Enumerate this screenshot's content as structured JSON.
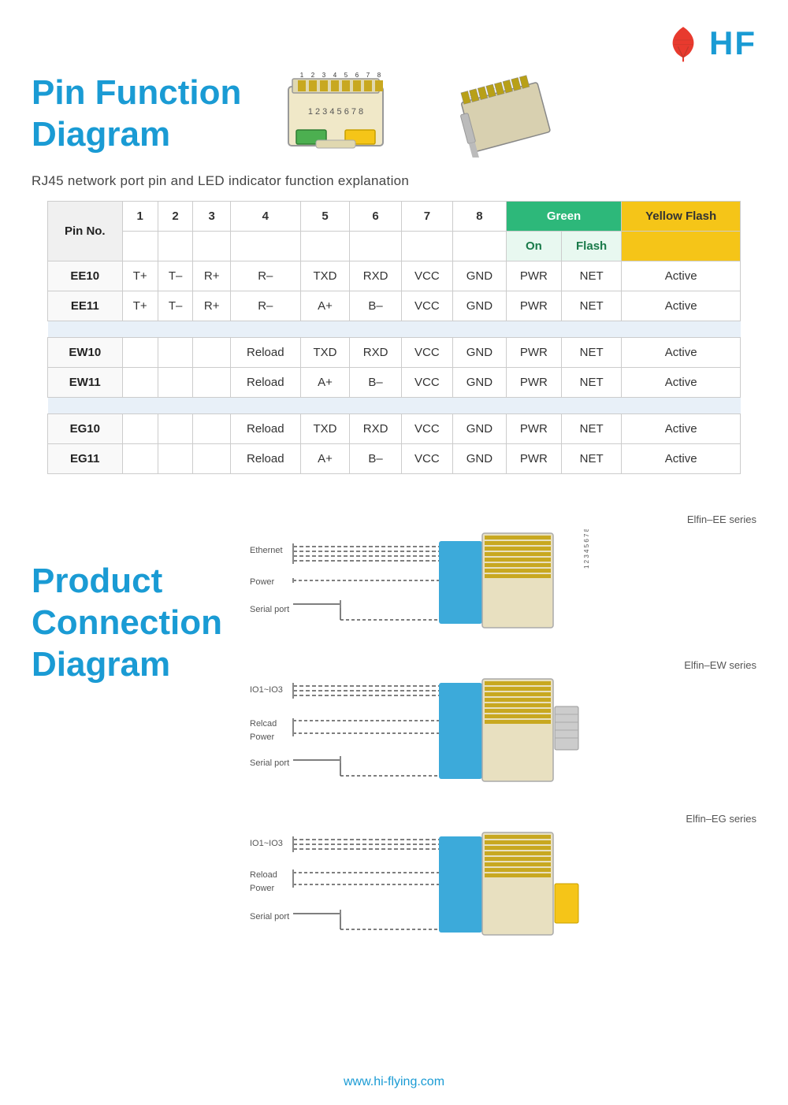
{
  "header": {
    "logo_text": "HF",
    "website": "www.hi-flying.com"
  },
  "title": {
    "main": "Pin Function",
    "sub": "Diagram"
  },
  "subtitle": "RJ45 network port pin and LED indicator function explanation",
  "table": {
    "col_header": [
      "Pin No.",
      "1",
      "2",
      "3",
      "4",
      "5",
      "6",
      "7",
      "8"
    ],
    "led_headers": {
      "green": "Green",
      "green_on": "On",
      "green_flash": "Flash",
      "yellow_flash": "Yellow Flash"
    },
    "rows": [
      {
        "label": "EE10",
        "pins": [
          "T+",
          "T–",
          "R+",
          "R–",
          "TXD",
          "RXD",
          "VCC",
          "GND"
        ],
        "led": [
          "PWR",
          "NET",
          "Active"
        ]
      },
      {
        "label": "EE11",
        "pins": [
          "T+",
          "T–",
          "R+",
          "R–",
          "A+",
          "B–",
          "VCC",
          "GND"
        ],
        "led": [
          "PWR",
          "NET",
          "Active"
        ]
      },
      {
        "label": "EW10",
        "pins": [
          "",
          "",
          "",
          "Reload",
          "TXD",
          "RXD",
          "VCC",
          "GND"
        ],
        "led": [
          "PWR",
          "NET",
          "Active"
        ]
      },
      {
        "label": "EW11",
        "pins": [
          "",
          "",
          "",
          "Reload",
          "A+",
          "B–",
          "VCC",
          "GND"
        ],
        "led": [
          "PWR",
          "NET",
          "Active"
        ]
      },
      {
        "label": "EG10",
        "pins": [
          "",
          "",
          "",
          "Reload",
          "TXD",
          "RXD",
          "VCC",
          "GND"
        ],
        "led": [
          "PWR",
          "NET",
          "Active"
        ]
      },
      {
        "label": "EG11",
        "pins": [
          "",
          "",
          "",
          "Reload",
          "A+",
          "B–",
          "VCC",
          "GND"
        ],
        "led": [
          "PWR",
          "NET",
          "Active"
        ]
      }
    ]
  },
  "product": {
    "title_line1": "Product",
    "title_line2": "Connection",
    "title_line3": "Diagram"
  },
  "diagrams": [
    {
      "left_labels": [
        "Ethernet",
        "Power",
        "Serial port"
      ],
      "series": "Elfin–EE series",
      "accent_color": "#1a9bd4"
    },
    {
      "left_labels": [
        "IO1~IO3",
        "Relcad",
        "Power",
        "Serial port"
      ],
      "series": "Elfin–EW series",
      "accent_color": "#1a9bd4"
    },
    {
      "left_labels": [
        "IO1~IO3",
        "Reload",
        "Power",
        "Serial port"
      ],
      "series": "Elfin–EG series",
      "accent_color": "#f5c518"
    }
  ]
}
